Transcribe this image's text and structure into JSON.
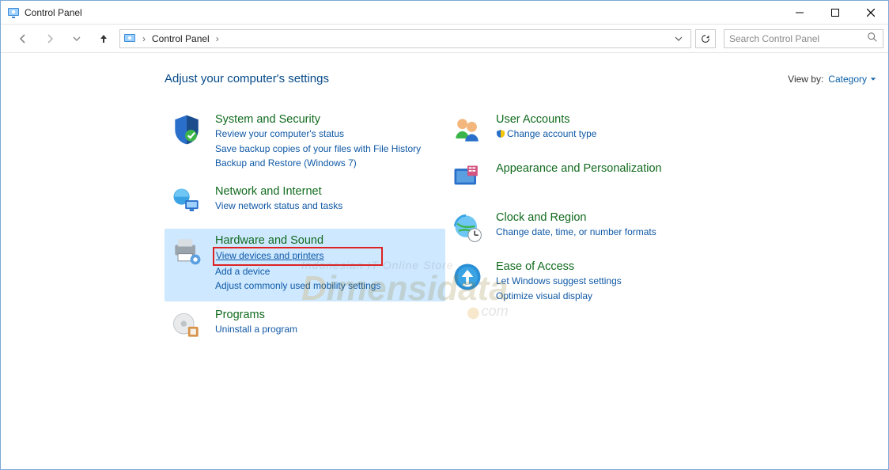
{
  "window": {
    "title": "Control Panel"
  },
  "breadcrumb": {
    "root": "Control Panel"
  },
  "search": {
    "placeholder": "Search Control Panel"
  },
  "header": {
    "heading": "Adjust your computer's settings",
    "viewby_label": "View by:",
    "viewby_value": "Category"
  },
  "left": [
    {
      "id": "system-security",
      "title": "System and Security",
      "links": [
        "Review your computer's status",
        "Save backup copies of your files with File History",
        "Backup and Restore (Windows 7)"
      ]
    },
    {
      "id": "network-internet",
      "title": "Network and Internet",
      "links": [
        "View network status and tasks"
      ]
    },
    {
      "id": "hardware-sound",
      "title": "Hardware and Sound",
      "highlight": true,
      "links": [
        "View devices and printers",
        "Add a device",
        "Adjust commonly used mobility settings"
      ],
      "highlight_link_index": 0
    },
    {
      "id": "programs",
      "title": "Programs",
      "links": [
        "Uninstall a program"
      ]
    }
  ],
  "right": [
    {
      "id": "user-accounts",
      "title": "User Accounts",
      "links": [
        "Change account type"
      ],
      "uac": [
        true
      ]
    },
    {
      "id": "appearance-personalization",
      "title": "Appearance and Personalization",
      "links": []
    },
    {
      "id": "clock-region",
      "title": "Clock and Region",
      "links": [
        "Change date, time, or number formats"
      ]
    },
    {
      "id": "ease-of-access",
      "title": "Ease of Access",
      "links": [
        "Let Windows suggest settings",
        "Optimize visual display"
      ]
    }
  ],
  "watermark": {
    "line1": "Indonesian IT Online Store",
    "brand": "imensidata",
    "suffix": "com"
  }
}
